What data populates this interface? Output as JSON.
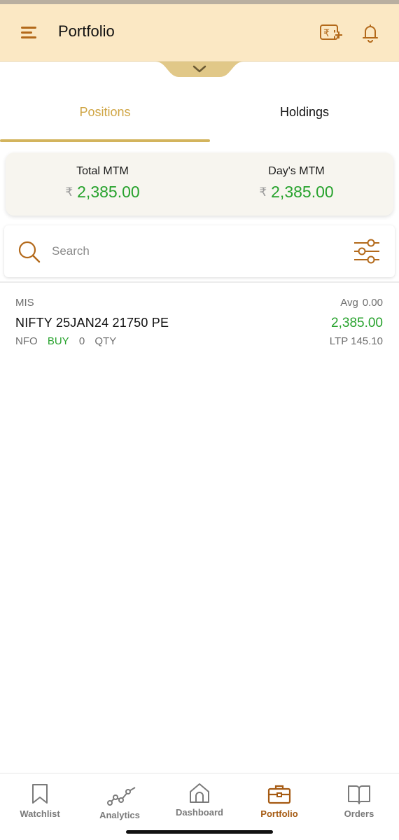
{
  "header": {
    "title": "Portfolio"
  },
  "tabs": [
    {
      "label": "Positions",
      "active": true
    },
    {
      "label": "Holdings",
      "active": false
    }
  ],
  "mtm": {
    "currency_symbol": "₹",
    "total_label": "Total MTM",
    "total_value": "2,385.00",
    "day_label": "Day's MTM",
    "day_value": "2,385.00"
  },
  "search": {
    "placeholder": "Search",
    "value": ""
  },
  "positions": [
    {
      "product": "MIS",
      "avg_label": "Avg",
      "avg_value": "0.00",
      "symbol": "NIFTY 25JAN24 21750 PE",
      "pnl": "2,385.00",
      "exchange": "NFO",
      "side": "BUY",
      "qty": "0",
      "qty_label": "QTY",
      "ltp_label": "LTP",
      "ltp_value": "145.10"
    }
  ],
  "bottom_nav": [
    {
      "label": "Watchlist",
      "icon": "bookmark-icon",
      "active": false
    },
    {
      "label": "Analytics",
      "icon": "analytics-icon",
      "active": false
    },
    {
      "label": "Dashboard",
      "icon": "home-icon",
      "active": false
    },
    {
      "label": "Portfolio",
      "icon": "briefcase-icon",
      "active": true
    },
    {
      "label": "Orders",
      "icon": "book-icon",
      "active": false
    }
  ],
  "colors": {
    "header_bg": "#fbe8c4",
    "accent": "#b3691a",
    "tab_active": "#cfa544",
    "profit_green": "#27a22d"
  }
}
